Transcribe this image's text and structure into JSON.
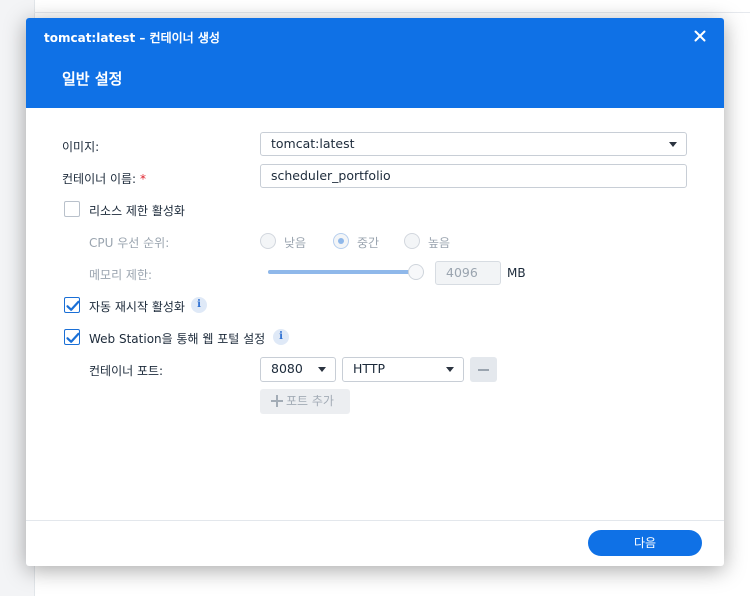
{
  "window": {
    "title": "tomcat:latest – 컨테이너 생성",
    "step_title": "일반 설정"
  },
  "form": {
    "image_label": "이미지:",
    "image_value": "tomcat:latest",
    "name_label": "컨테이너 이름:",
    "name_required": "*",
    "name_value": "scheduler_portfolio",
    "resource_limit_label": "리소스 제한 활성화",
    "resource_limit_checked": false,
    "cpu_priority_label": "CPU 우선 순위:",
    "cpu_options": [
      "낮음",
      "중간",
      "높음"
    ],
    "cpu_selected": "중간",
    "memory_label": "메모리 제한:",
    "memory_value": "4096",
    "memory_unit": "MB",
    "memory_fraction": 1.0,
    "auto_restart_label": "자동 재시작 활성화",
    "auto_restart_checked": true,
    "web_station_label": "Web Station을 통해 웹 포털 설정",
    "web_station_checked": true,
    "container_port_label": "컨테이너 포트:",
    "port_value": "8080",
    "protocol_value": "HTTP",
    "add_port_label": "포트 추가"
  },
  "footer": {
    "next_label": "다음"
  },
  "colors": {
    "accent": "#0f71e6",
    "check": "#1a6fd6",
    "disabled_text": "#9aa4af"
  },
  "icons": {
    "close": "close-icon",
    "info": "info-icon",
    "caret": "chevron-down-icon",
    "check": "check-icon",
    "minus": "minus-icon",
    "plus": "plus-icon"
  }
}
